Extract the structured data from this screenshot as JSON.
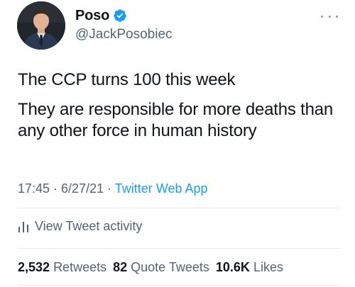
{
  "user": {
    "display_name": "Poso",
    "handle": "@JackPosobiec",
    "verified": true,
    "avatar_icon": "profile-photo",
    "verified_icon": "verified-badge-icon"
  },
  "tweet": {
    "paragraphs": [
      "The CCP turns 100 this week",
      "They are responsible for more deaths than any other force in human history"
    ],
    "time": "17:45",
    "separator": " · ",
    "date": "6/27/21",
    "source": "Twitter Web App"
  },
  "activity": {
    "label": "View Tweet activity",
    "icon": "bar-chart-icon"
  },
  "stats": {
    "retweets_count": "2,532",
    "retweets_label": "Retweets",
    "quotes_count": "82",
    "quotes_label": "Quote Tweets",
    "likes_count": "10.6K",
    "likes_label": "Likes"
  },
  "colors": {
    "accent": "#1d9bf0",
    "text_primary": "#0f1419",
    "text_secondary": "#536471",
    "divider": "#e6ecf0"
  }
}
